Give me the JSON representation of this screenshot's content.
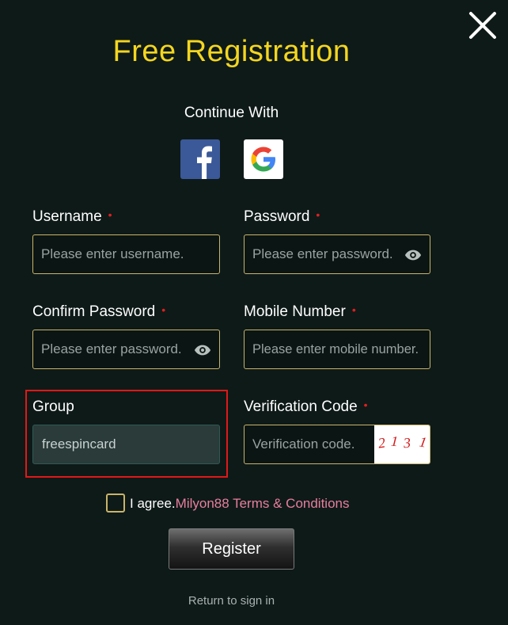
{
  "title": "Free Registration",
  "continue_with": "Continue With",
  "social": [
    {
      "icon": "facebook-icon",
      "color": "#3b5998"
    },
    {
      "icon": "google-icon",
      "color": "#ffffff"
    }
  ],
  "required_marker": "•",
  "fields": {
    "username": {
      "label": "Username",
      "placeholder": "Please enter username.",
      "required": true
    },
    "password": {
      "label": "Password",
      "placeholder": "Please enter password.",
      "required": true
    },
    "confirm_password": {
      "label": "Confirm Password",
      "placeholder": "Please enter password.",
      "required": true
    },
    "mobile": {
      "label": "Mobile Number",
      "placeholder": "Please enter mobile number.",
      "required": true
    },
    "group": {
      "label": "Group",
      "value": "freespincard",
      "required": false
    },
    "verification": {
      "label": "Verification Code",
      "placeholder": "Verification code.",
      "required": true,
      "captcha": [
        "2",
        "1",
        "3",
        "1"
      ]
    }
  },
  "agree": {
    "prefix": "I agree.",
    "link": "Milyon88 Terms & Conditions"
  },
  "register_label": "Register",
  "return_label": "Return to sign in",
  "colors": {
    "accent": "#f4d61f",
    "required": "#e02020",
    "link": "#e87e9e",
    "highlight": "#e01818",
    "border": "#c9b46a"
  }
}
